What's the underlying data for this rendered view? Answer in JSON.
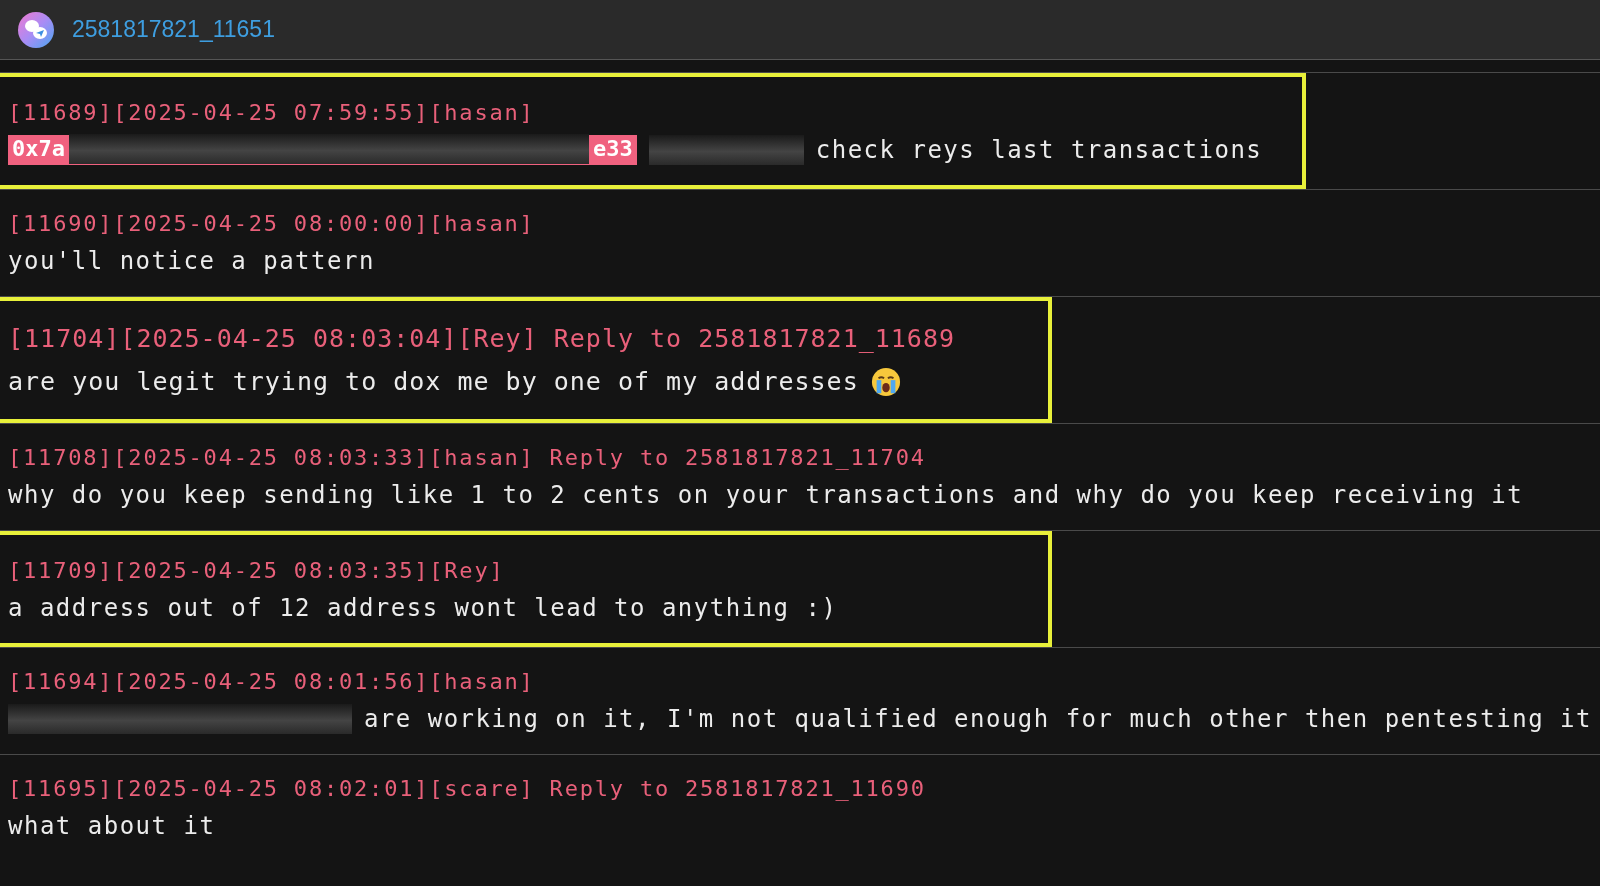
{
  "window": {
    "title": "2581817821_11651"
  },
  "messages": [
    {
      "header": "[11689][2025-04-25 07:59:55][hasan]",
      "highlighted": true,
      "large": false,
      "parts": [
        {
          "kind": "address",
          "prefix": "0x7a",
          "suffix": "e33"
        },
        {
          "kind": "redacted"
        },
        {
          "kind": "text",
          "text": "check reys last transactions"
        }
      ]
    },
    {
      "header": "[11690][2025-04-25 08:00:00][hasan]",
      "highlighted": false,
      "large": false,
      "parts": [
        {
          "kind": "text",
          "text": "you'll notice a pattern"
        }
      ]
    },
    {
      "header": "[11704][2025-04-25 08:03:04][Rey] Reply to 2581817821_11689",
      "highlighted": true,
      "large": true,
      "parts": [
        {
          "kind": "text",
          "text": "are you legit trying to dox me by one of my addresses"
        },
        {
          "kind": "emoji"
        }
      ]
    },
    {
      "header": "[11708][2025-04-25 08:03:33][hasan] Reply to 2581817821_11704",
      "highlighted": false,
      "large": false,
      "parts": [
        {
          "kind": "text",
          "text": "why do you keep sending like 1 to 2 cents on your transactions and why do you keep receiving it"
        }
      ]
    },
    {
      "header": "[11709][2025-04-25 08:03:35][Rey]",
      "highlighted": true,
      "large": false,
      "parts": [
        {
          "kind": "text",
          "text": "a address out of 12 address wont lead to anything :)"
        }
      ]
    },
    {
      "header": "[11694][2025-04-25 08:01:56][hasan]",
      "highlighted": false,
      "large": false,
      "parts": [
        {
          "kind": "redacted"
        },
        {
          "kind": "text",
          "text": "are working on it, I'm not qualified enough for much other then pentesting it"
        }
      ]
    },
    {
      "header": "[11695][2025-04-25 08:02:01][scare] Reply to 2581817821_11690",
      "highlighted": false,
      "large": false,
      "parts": [
        {
          "kind": "text",
          "text": "what about it"
        }
      ]
    }
  ]
}
